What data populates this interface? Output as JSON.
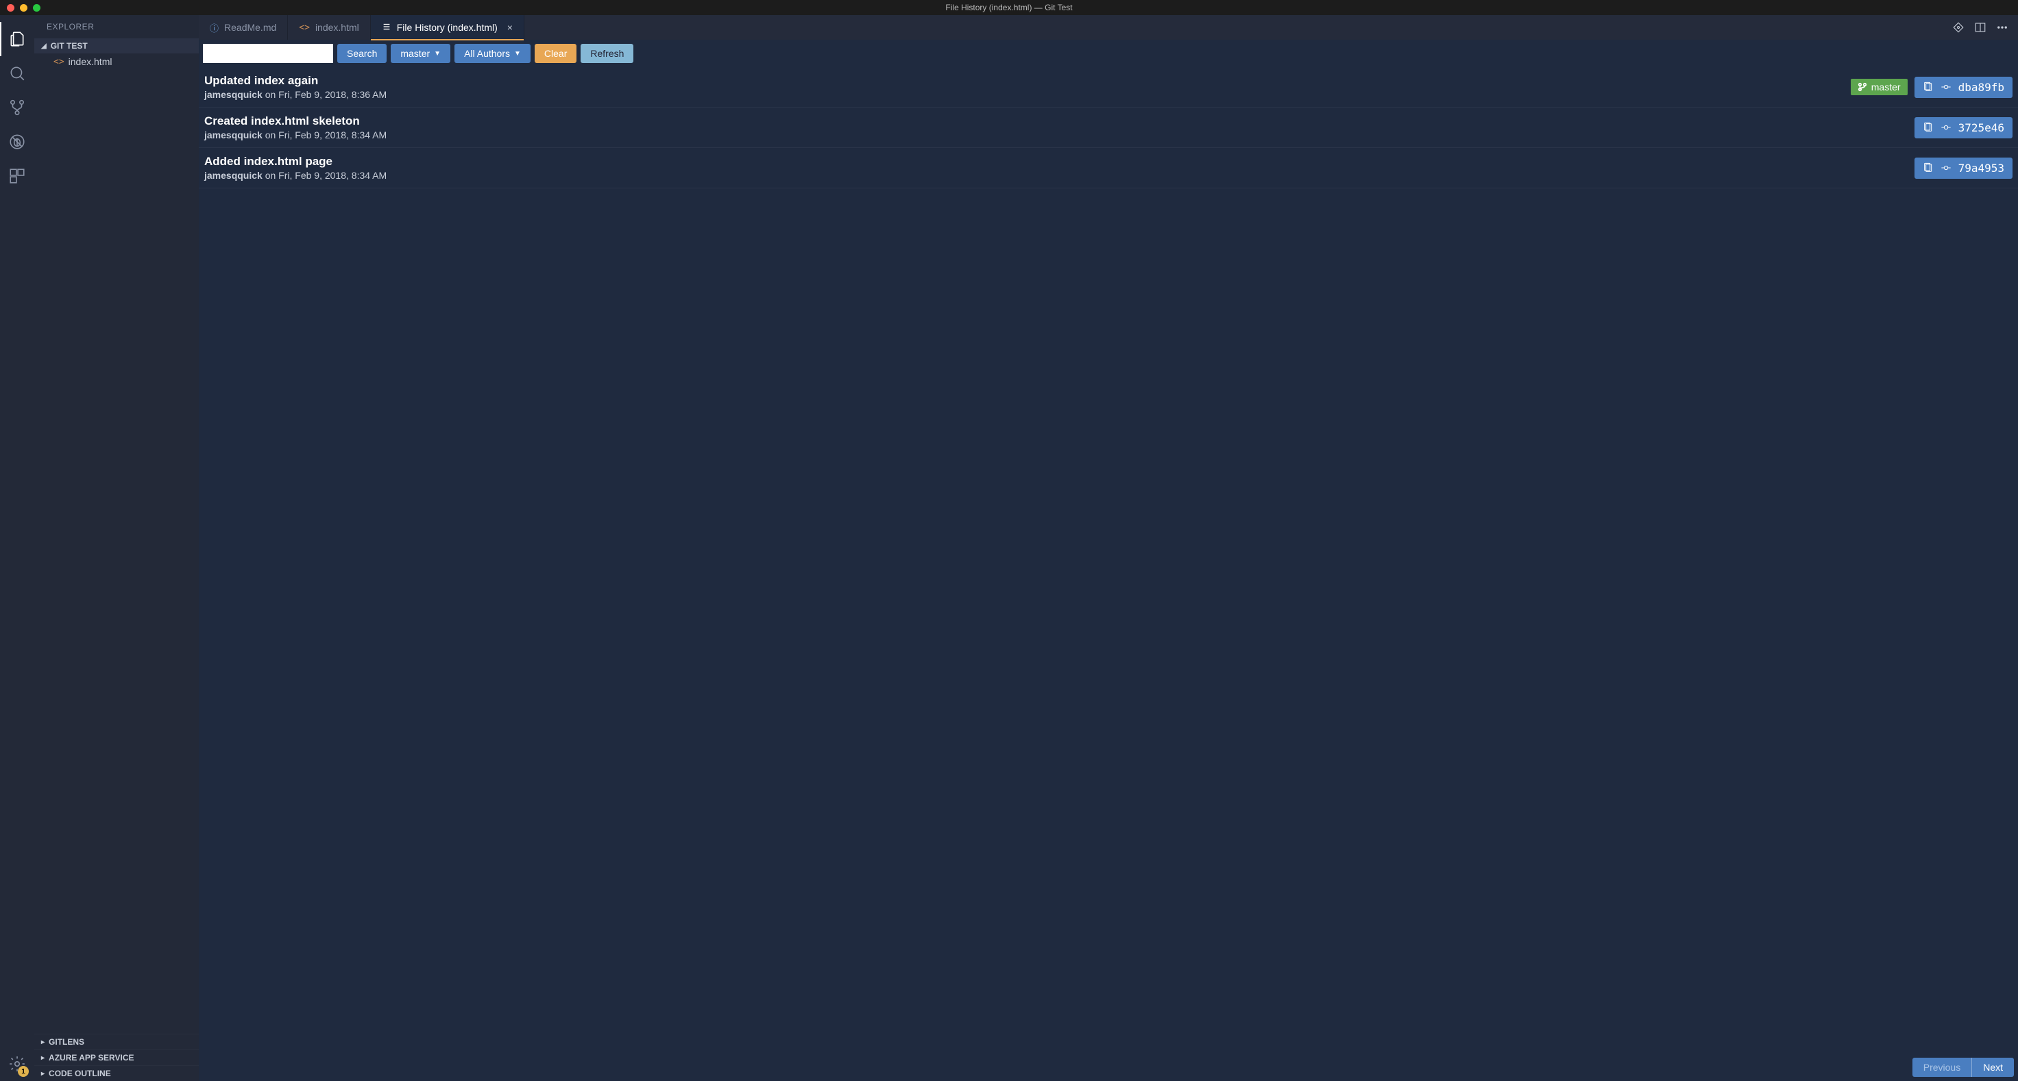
{
  "titlebar": {
    "title": "File History (index.html) — Git Test"
  },
  "activity_bar": {
    "gear_badge": "1"
  },
  "sidebar": {
    "title": "EXPLORER",
    "project": "GIT TEST",
    "files": [
      {
        "name": "index.html"
      }
    ],
    "bottom_sections": [
      {
        "label": "GITLENS"
      },
      {
        "label": "AZURE APP SERVICE"
      },
      {
        "label": "CODE OUTLINE"
      }
    ]
  },
  "tabs": [
    {
      "label": "ReadMe.md",
      "icon": "info",
      "active": false,
      "closable": false
    },
    {
      "label": "index.html",
      "icon": "html",
      "active": false,
      "closable": false
    },
    {
      "label": "File History (index.html)",
      "icon": "list",
      "active": true,
      "closable": true
    }
  ],
  "filters": {
    "search_value": "",
    "search_btn": "Search",
    "branch_btn": "master",
    "authors_btn": "All Authors",
    "clear_btn": "Clear",
    "refresh_btn": "Refresh"
  },
  "commits": [
    {
      "title": "Updated index again",
      "author": "jamesqquick",
      "date": "on Fri, Feb 9, 2018, 8:36 AM",
      "branch": "master",
      "hash": "dba89fb"
    },
    {
      "title": "Created index.html skeleton",
      "author": "jamesqquick",
      "date": "on Fri, Feb 9, 2018, 8:34 AM",
      "branch": null,
      "hash": "3725e46"
    },
    {
      "title": "Added index.html page",
      "author": "jamesqquick",
      "date": "on Fri, Feb 9, 2018, 8:34 AM",
      "branch": null,
      "hash": "79a4953"
    }
  ],
  "pager": {
    "prev": "Previous",
    "next": "Next"
  }
}
